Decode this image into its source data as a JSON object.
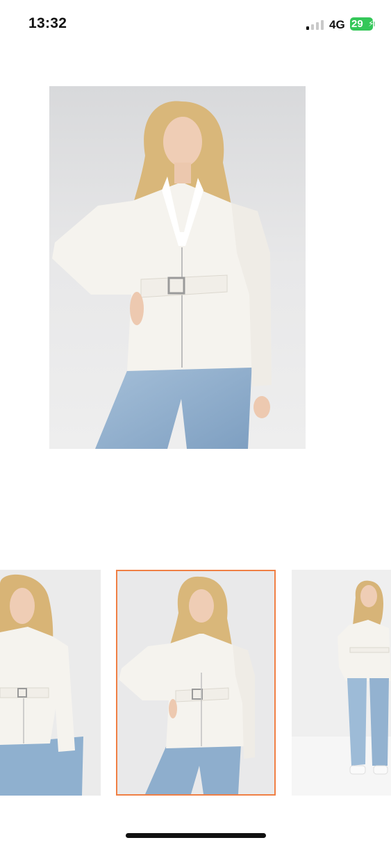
{
  "status_bar": {
    "time": "13:32",
    "network": "4G",
    "battery": "29",
    "battery_color": "#34c759"
  },
  "gallery": {
    "selected_index": 1,
    "accent_color": "#f07f44",
    "thumbnails": [
      {
        "label": "product-photo-front-cropped"
      },
      {
        "label": "product-photo-front"
      },
      {
        "label": "product-photo-full-length"
      }
    ]
  }
}
